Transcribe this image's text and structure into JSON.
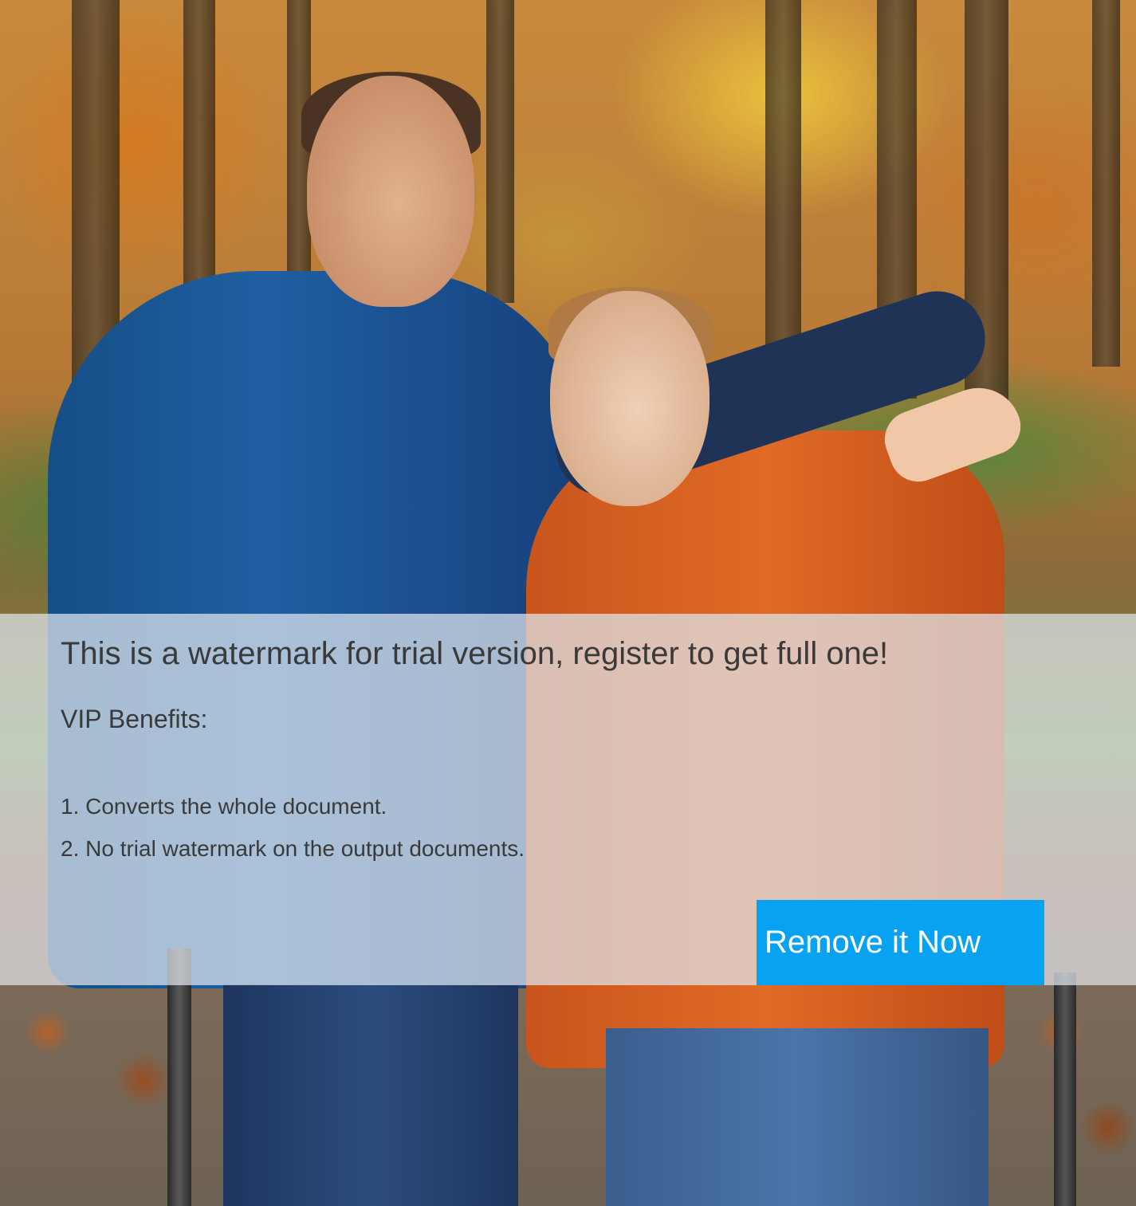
{
  "watermark": {
    "title": "This is a watermark for trial version, register to get full one!",
    "subtitle": "VIP Benefits:",
    "benefits": [
      "1. Converts the whole document.",
      "2. No trial watermark on the output documents."
    ],
    "button_label": "Remove it Now"
  },
  "colors": {
    "button_background": "#07a2f2",
    "button_text": "#ffffff",
    "overlay_background": "#e1e8ee",
    "text": "#3a3a3a"
  }
}
